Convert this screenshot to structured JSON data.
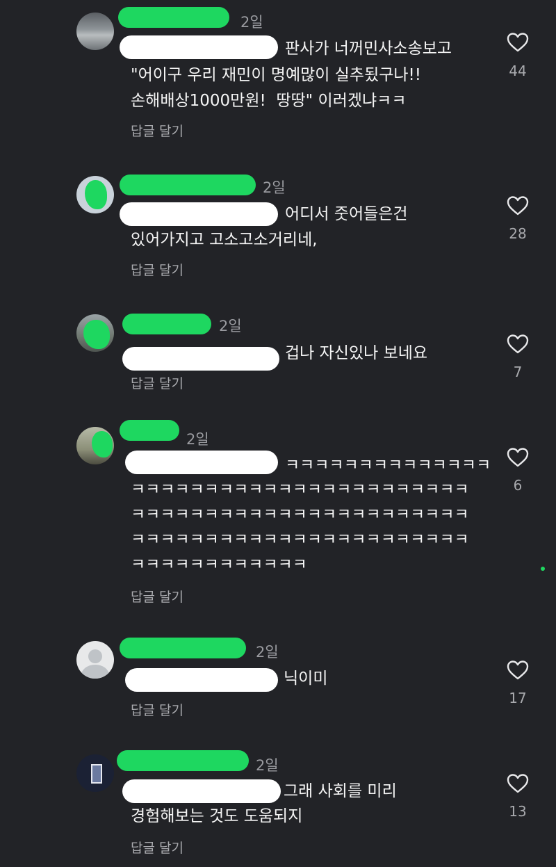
{
  "comments": [
    {
      "date": "2일",
      "text_lines": [
        "판사가 너꺼민사소송보고",
        "\"어이구 우리 재민이 명예많이 실추됬구나!!",
        "손해배상1000만원!  땅땅\" 이러겠냐ㅋㅋ"
      ],
      "reply_label": "답글 달기",
      "likes": "44"
    },
    {
      "date": "2일",
      "text_lines": [
        "어디서 줏어들은건",
        "있어가지고 고소고소거리네,"
      ],
      "reply_label": "답글 달기",
      "likes": "28"
    },
    {
      "date": "2일",
      "text_lines": [
        "겁나 자신있나 보네요"
      ],
      "reply_label": "답글 달기",
      "likes": "7"
    },
    {
      "date": "2일",
      "text_lines": [
        "ㅋㅋㅋㅋㅋㅋㅋㅋㅋㅋㅋㅋㅋㅋ",
        "ㅋㅋㅋㅋㅋㅋㅋㅋㅋㅋㅋㅋㅋㅋㅋㅋㅋㅋㅋㅋㅋㅋㅋ",
        "ㅋㅋㅋㅋㅋㅋㅋㅋㅋㅋㅋㅋㅋㅋㅋㅋㅋㅋㅋㅋㅋㅋㅋ",
        "ㅋㅋㅋㅋㅋㅋㅋㅋㅋㅋㅋㅋㅋㅋㅋㅋㅋㅋㅋㅋㅋㅋㅋ",
        "ㅋㅋㅋㅋㅋㅋㅋㅋㅋㅋㅋㅋ"
      ],
      "reply_label": "답글 달기",
      "likes": "6"
    },
    {
      "date": "2일",
      "text_lines": [
        "닉이미"
      ],
      "reply_label": "답글 달기",
      "likes": "17"
    },
    {
      "date": "2일",
      "text_lines": [
        "그래 사회를 미리",
        "경험해보는 것도 도움되지"
      ],
      "reply_label": "답글 달기",
      "likes": "13"
    }
  ],
  "colors": {
    "background": "#222327",
    "redaction_green": "#1ed760",
    "redaction_white": "#ffffff",
    "muted_text": "#a9aaae"
  },
  "icons": {
    "like": "heart-outline-icon",
    "default_avatar": "person-silhouette-icon"
  }
}
